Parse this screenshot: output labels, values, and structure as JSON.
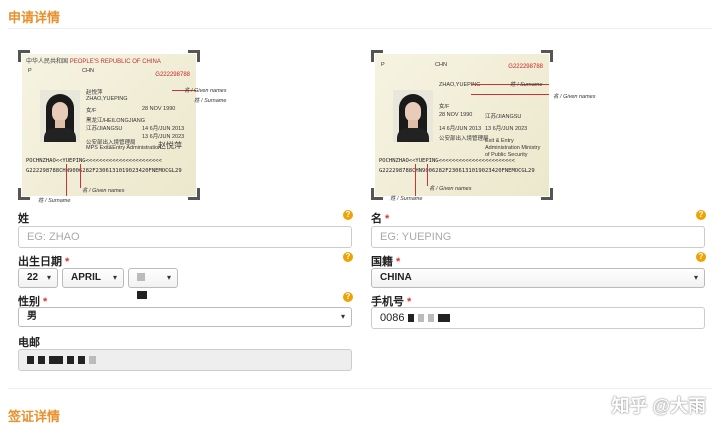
{
  "sections": {
    "application": "申请详情",
    "visa": "签证详情"
  },
  "passport": {
    "header_cn": "中华人民共和国",
    "header_en": "PEOPLE'S REPUBLIC OF CHINA",
    "type_label": "P",
    "country": "CHN",
    "number": "G222298788",
    "surname_cn": "赵",
    "given_cn": "悦萍",
    "name_pinyin": "ZHAO,YUEPING",
    "sex": "女/F",
    "birthplace": "黑龙江/HEILONGJIANG",
    "issue_place": "江苏/JIANGSU",
    "dob": "28 NOV 1990",
    "issue_date": "14 6月/JUN 2013",
    "expiry_date": "13 6月/JUN 2023",
    "authority_cn": "公安部出入境管理局",
    "authority_en": "MPS Exit&Entry Administration",
    "authority2_en": "Exit & Entry Administration Ministry of Public Security",
    "signature": "赵悦萍",
    "mrz1": "POCHNZHAO<<YUEPING<<<<<<<<<<<<<<<<<<<<<<<",
    "mrz2": "G222298788CHN9006282F2306131019023420FNEMOCGL29",
    "ann_given": "名 / Given names",
    "ann_surname": "姓 / Surname"
  },
  "form": {
    "surname": {
      "label": "姓",
      "placeholder": "EG: ZHAO"
    },
    "given": {
      "label": "名",
      "placeholder": "EG: YUEPING"
    },
    "dob": {
      "label": "出生日期",
      "day": "22",
      "month": "APRIL"
    },
    "nationality": {
      "label": "国籍",
      "value": "CHINA"
    },
    "gender": {
      "label": "性别",
      "value": "男"
    },
    "phone": {
      "label": "手机号",
      "prefix": "0086"
    },
    "email": {
      "label": "电邮"
    }
  },
  "help_glyph": "?",
  "required_mark": "*",
  "chevron": "▾",
  "watermark": "知乎 @大雨",
  "colors": {
    "accent": "#e8902b",
    "required": "#d33",
    "help": "#f0a200"
  }
}
